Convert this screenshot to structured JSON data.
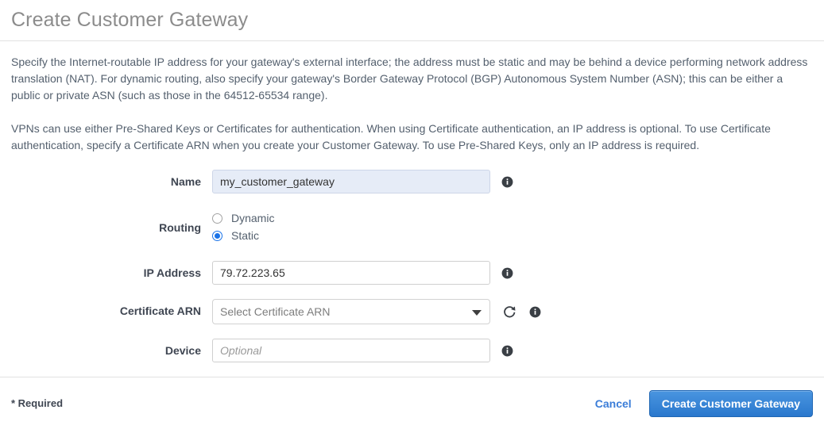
{
  "dialog": {
    "title": "Create Customer Gateway",
    "paragraphs": [
      "Specify the Internet-routable IP address for your gateway's external interface; the address must be static and may be behind a device performing network address translation (NAT). For dynamic routing, also specify your gateway's Border Gateway Protocol (BGP) Autonomous System Number (ASN); this can be either a public or private ASN (such as those in the 64512-65534 range).",
      "VPNs can use either Pre-Shared Keys or Certificates for authentication. When using Certificate authentication, an IP address is optional. To use Certificate authentication, specify a Certificate ARN when you create your Customer Gateway. To use Pre-Shared Keys, only an IP address is required."
    ]
  },
  "form": {
    "name": {
      "label": "Name",
      "value": "my_customer_gateway",
      "placeholder": "",
      "info_icon": "info-icon"
    },
    "routing": {
      "label": "Routing",
      "options": [
        {
          "label": "Dynamic",
          "value": "dynamic",
          "selected": false
        },
        {
          "label": "Static",
          "value": "static",
          "selected": true
        }
      ]
    },
    "ip_address": {
      "label": "IP Address",
      "value": "79.72.223.65",
      "placeholder": "",
      "info_icon": "info-icon"
    },
    "certificate_arn": {
      "label": "Certificate ARN",
      "selected_option": "Select Certificate ARN",
      "options": [
        "Select Certificate ARN"
      ],
      "dropdown_icon": "chevron-down-icon",
      "refresh_icon": "refresh-icon",
      "info_icon": "info-icon"
    },
    "device": {
      "label": "Device",
      "value": "",
      "placeholder": "Optional",
      "info_icon": "info-icon"
    }
  },
  "footer": {
    "required_note": "* Required",
    "cancel_label": "Cancel",
    "submit_label": "Create Customer Gateway"
  },
  "colors": {
    "title": "#8c8c8c",
    "body_text": "#54606e",
    "label": "#3f4652",
    "link": "#3b7dd8",
    "primary_button": "#2a78cd",
    "radio_selected": "#1a73e8",
    "focused_input_bg": "#e6ecf7",
    "divider": "#e2e2e2"
  }
}
